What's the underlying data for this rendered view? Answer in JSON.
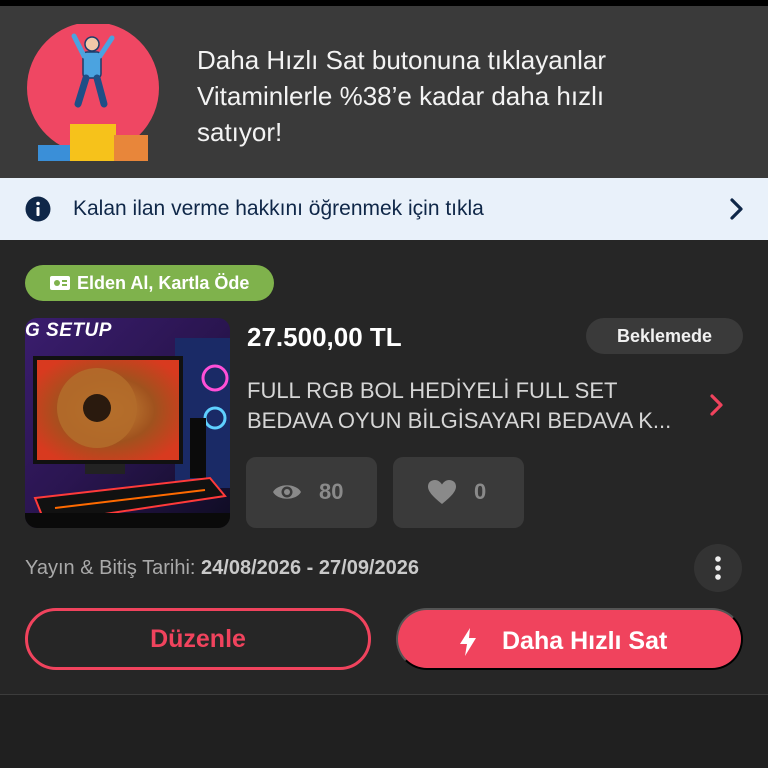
{
  "promo": {
    "line1": "Daha Hızlı Sat butonuna tıklayanlar",
    "line2": "Vitaminlerle %38’e kadar daha hızlı",
    "line3": "satıyor!"
  },
  "info_bar": {
    "text": "Kalan ilan verme hakkını öğrenmek için tıkla",
    "icon": "info-icon",
    "chevron_icon": "chevron-right-icon"
  },
  "listing": {
    "badge": "Elden Al, Kartla Öde",
    "image_label": "G SETUP",
    "price": "27.500,00 TL",
    "status": "Beklemede",
    "title_line1": "FULL RGB BOL HEDİYELİ FULL SET",
    "title_line2": "BEDAVA OYUN BİLGİSAYARI BEDAVA K...",
    "views": "80",
    "likes": "0",
    "dates_label": "Yayın & Bitiş Tarihi:",
    "dates_value": "24/08/2026 - 27/09/2026"
  },
  "actions": {
    "edit": "Düzenle",
    "fast_sell": "Daha Hızlı Sat"
  },
  "colors": {
    "accent": "#f0435d",
    "badge_green": "#7fb24c",
    "info_bg": "#e9f1fa",
    "info_text": "#0f2748",
    "card_bg": "#262626"
  }
}
